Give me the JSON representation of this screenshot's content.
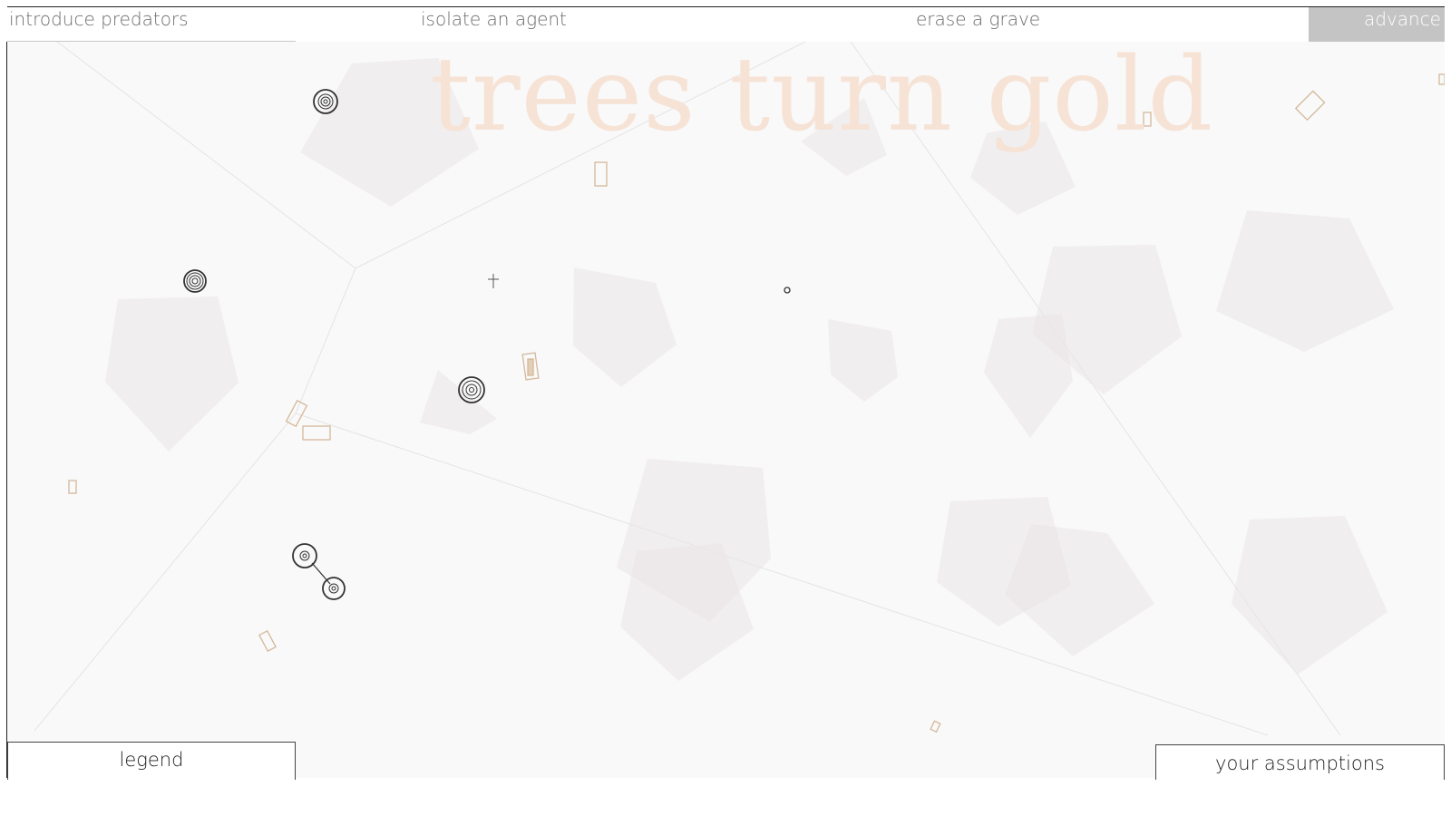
{
  "menu": {
    "introduce_predators": "introduce predators",
    "isolate_agent": "isolate an agent",
    "erase_grave": "erase a grave",
    "advance": "advance"
  },
  "scene": {
    "title": "trees turn gold"
  },
  "panels": {
    "legend": "legend",
    "assumptions": "your assumptions"
  },
  "colors": {
    "background": "#f9f9f9",
    "title": "#f6e3d6",
    "polygon_fill": "#ebe6e8",
    "marker": "#d4b89a",
    "agent": "#333333",
    "advance_bg": "#c4c4c4"
  },
  "icons": {
    "agent": "concentric-circle-agent-icon",
    "grave": "grave-cross-icon",
    "food": "rectangle-marker-icon"
  }
}
